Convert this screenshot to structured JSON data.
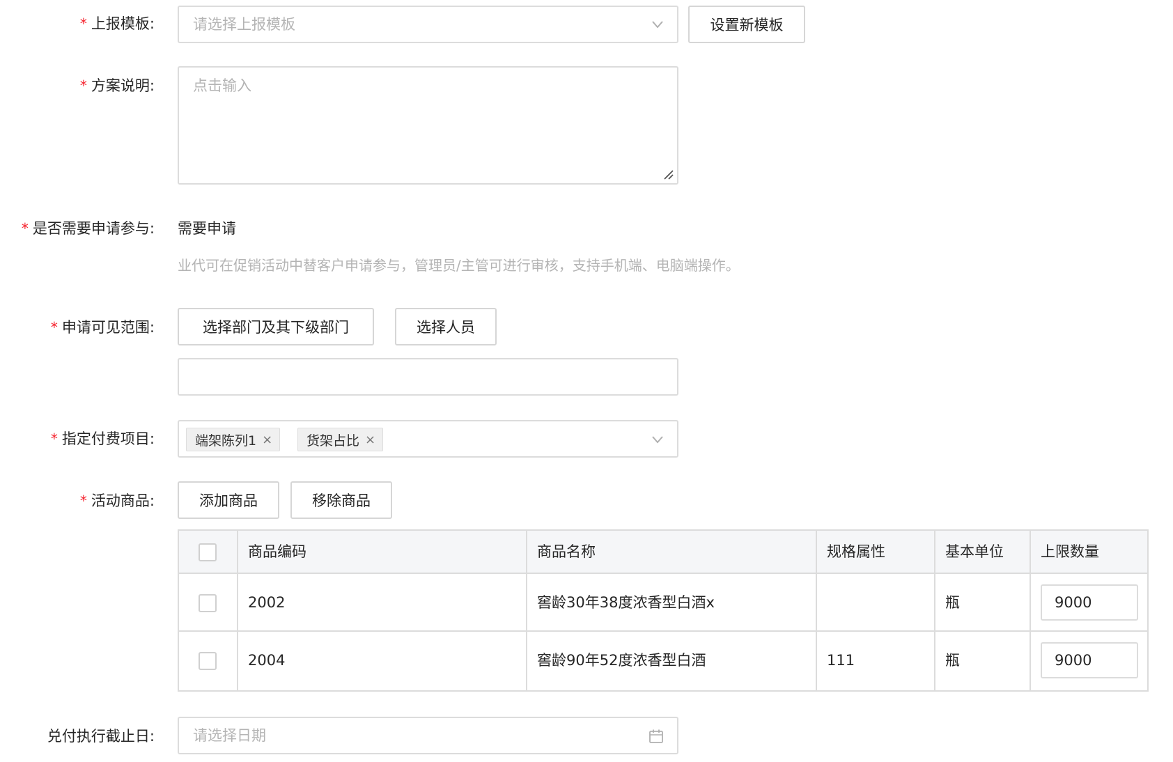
{
  "fields": {
    "template": {
      "label": "上报模板:",
      "required": "*",
      "placeholder": "请选择上报模板",
      "button": "设置新模板"
    },
    "description": {
      "label": "方案说明:",
      "required": "*",
      "placeholder": "点击输入"
    },
    "need_apply": {
      "label": "是否需要申请参与:",
      "required": "*",
      "value": "需要申请",
      "hint": "业代可在促销活动中替客户申请参与，管理员/主管可进行审核，支持手机端、电脑端操作。"
    },
    "visible_scope": {
      "label": "申请可见范围:",
      "required": "*",
      "dept_button": "选择部门及其下级部门",
      "person_button": "选择人员"
    },
    "fee_items": {
      "label": "指定付费项目:",
      "required": "*",
      "tags": [
        {
          "text": "端架陈列1",
          "close": "×"
        },
        {
          "text": "货架占比",
          "close": "×"
        }
      ]
    },
    "products": {
      "label": "活动商品:",
      "required": "*",
      "add_button": "添加商品",
      "remove_button": "移除商品"
    },
    "deadline": {
      "label": "兑付执行截止日:",
      "placeholder": "请选择日期"
    }
  },
  "table": {
    "columns": [
      "商品编码",
      "商品名称",
      "规格属性",
      "基本单位",
      "上限数量"
    ],
    "rows": [
      {
        "code": "2002",
        "name": "窖龄30年38度浓香型白酒x",
        "spec": "",
        "unit": "瓶",
        "limit": "9000"
      },
      {
        "code": "2004",
        "name": "窖龄90年52度浓香型白酒",
        "spec": "111",
        "unit": "瓶",
        "limit": "9000"
      }
    ]
  },
  "icons": {
    "dropdown": "chevron-down-icon",
    "calendar": "calendar-icon",
    "resize": "resize-handle-icon"
  },
  "colors": {
    "required": "#f5222d",
    "border": "#dcdcdc",
    "placeholder": "#b4b4b4",
    "hint": "#b4b4b4",
    "table_header_bg": "#f5f6f8"
  }
}
